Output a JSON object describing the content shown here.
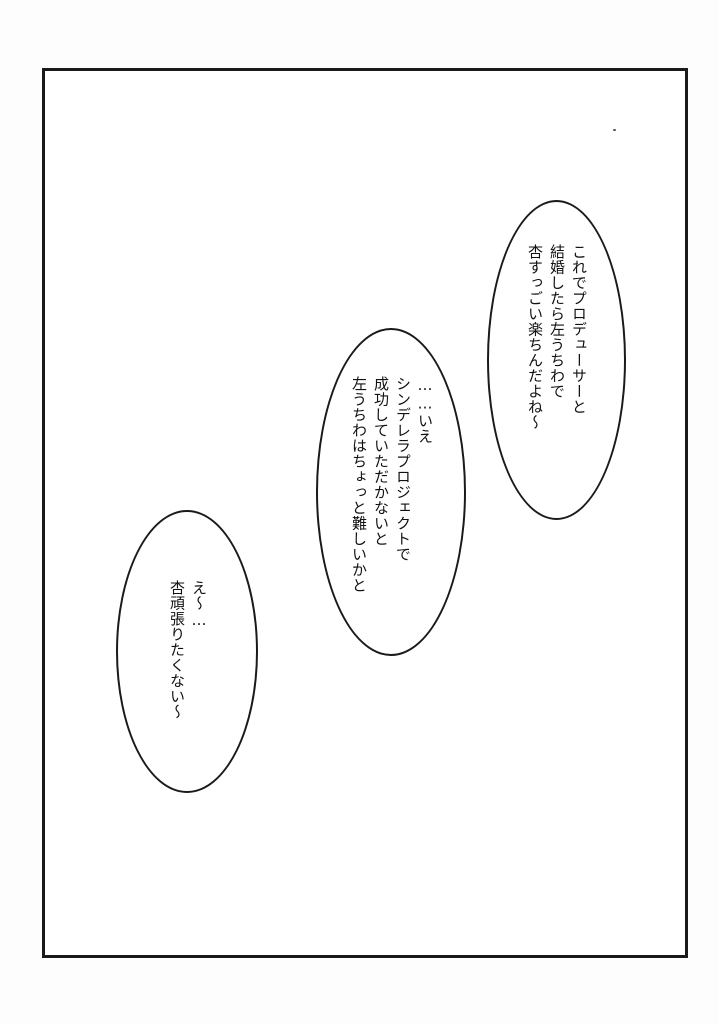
{
  "bubbles": [
    {
      "lines": [
        "これでプロデューサーと",
        "結婚したら左うちわで",
        "杏すっごい楽ちんだよね～"
      ]
    },
    {
      "lines": [
        "……いえ",
        "シンデレラプロジェクトで",
        "成功していただかないと",
        "左うちわはちょっと難しいかと"
      ]
    },
    {
      "lines": [
        "え～…",
        "杏頑張りたくない～"
      ]
    }
  ]
}
